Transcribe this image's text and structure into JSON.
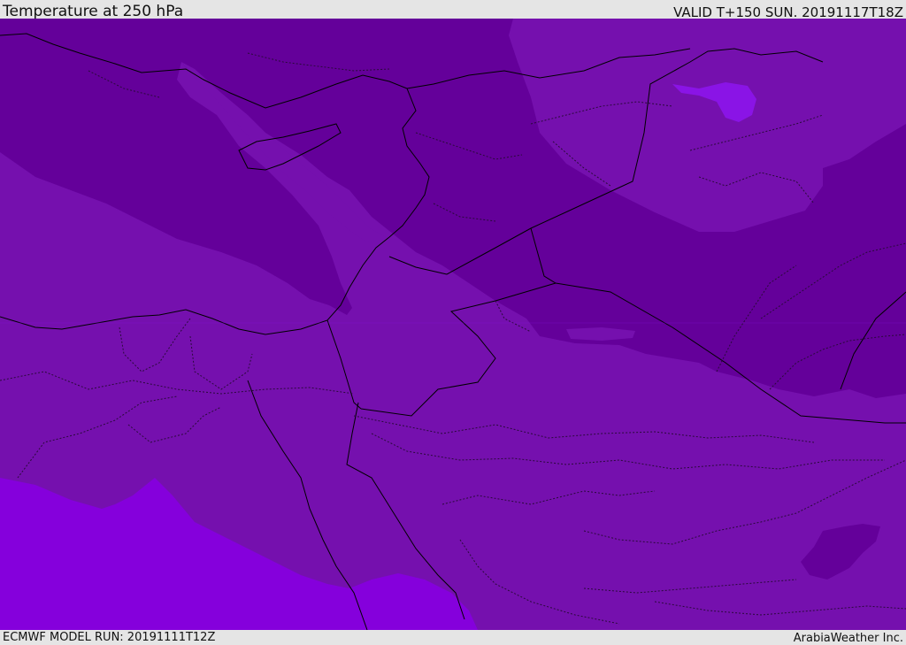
{
  "header": {
    "title": "Temperature at 250 hPa",
    "valid_time": "VALID T+150 SUN. 20191117T18Z"
  },
  "footer": {
    "model_run": "ECMWF MODEL RUN: 20191111T12Z",
    "credit": "ArabiaWeather Inc."
  },
  "map": {
    "colors": {
      "coldest_band": "#64009a",
      "cold_band": "#7510ae",
      "warm_band": "#8500dc",
      "cold_pocket": "#8a14e6",
      "coastline": "#000000",
      "border_dotted": "#2a0a3a"
    }
  }
}
